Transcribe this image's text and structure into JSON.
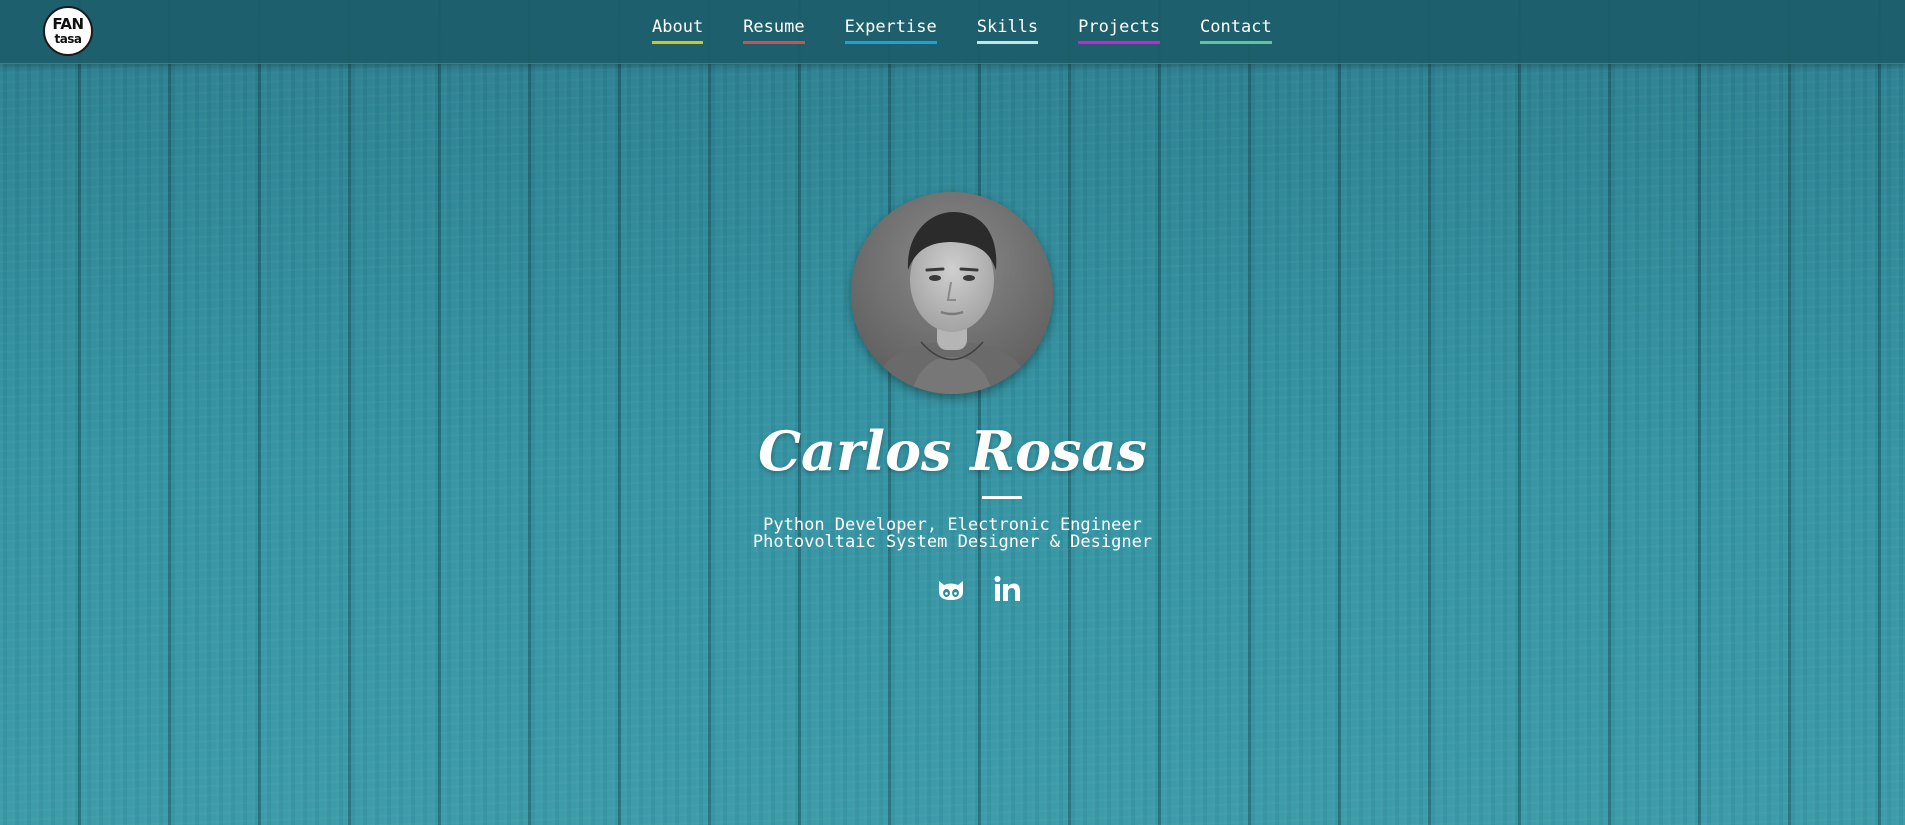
{
  "header": {
    "logo": {
      "line1": "FAN",
      "line2": "tasa"
    },
    "nav": [
      {
        "label": "About",
        "underline_color": "#d7c21c"
      },
      {
        "label": "Resume",
        "underline_color": "#d05050"
      },
      {
        "label": "Expertise",
        "underline_color": "#1ba2d6"
      },
      {
        "label": "Skills",
        "underline_color": "#bfe6e0"
      },
      {
        "label": "Projects",
        "underline_color": "#d21ed8"
      },
      {
        "label": "Contact",
        "underline_color": "#62c49a"
      }
    ]
  },
  "hero": {
    "name": "Carlos Rosas",
    "subtitle_line1": "Python Developer, Electronic Engineer",
    "subtitle_line2": "Photovoltaic System Designer & Designer",
    "social": [
      {
        "icon": "github-icon"
      },
      {
        "icon": "linkedin-icon"
      }
    ]
  },
  "colors": {
    "background": "#2f8a99",
    "header": "#1c5c69",
    "text": "#ffffff"
  }
}
